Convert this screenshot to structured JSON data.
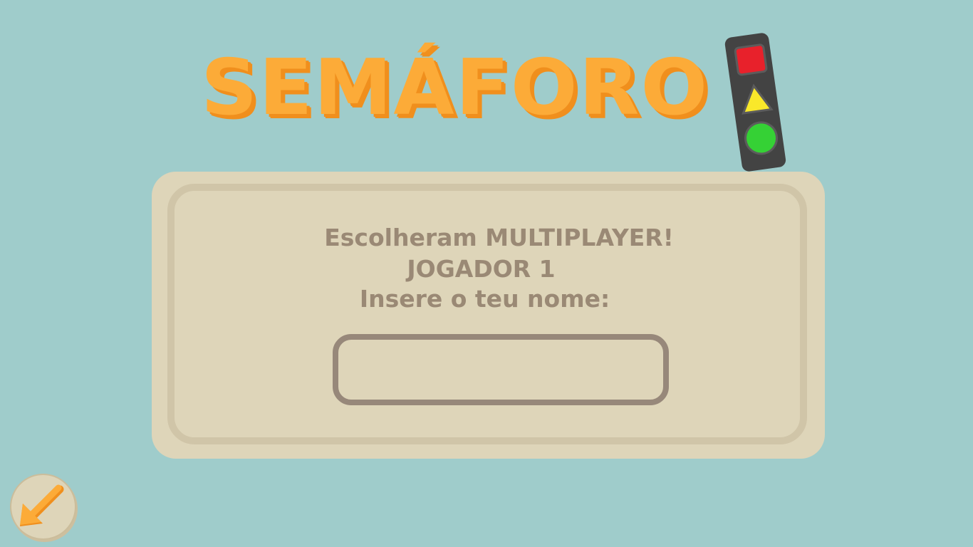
{
  "header": {
    "logo_text": "SEMÁFORO"
  },
  "dialog": {
    "line_1": "Escolheram MULTIPLAYER!",
    "line_2": "JOGADOR 1",
    "line_3": "Insere o teu nome:"
  },
  "name_input": {
    "value": "",
    "placeholder": ""
  },
  "back_button": {
    "icon": "arrow-down-left-icon"
  },
  "colors": {
    "background": "#9fcccb",
    "logo": "#fcab38",
    "panel": "#ded5b9",
    "text": "#9a8975",
    "light_red": "#e8212b",
    "light_yellow": "#f9e82a",
    "light_green": "#35d135"
  }
}
